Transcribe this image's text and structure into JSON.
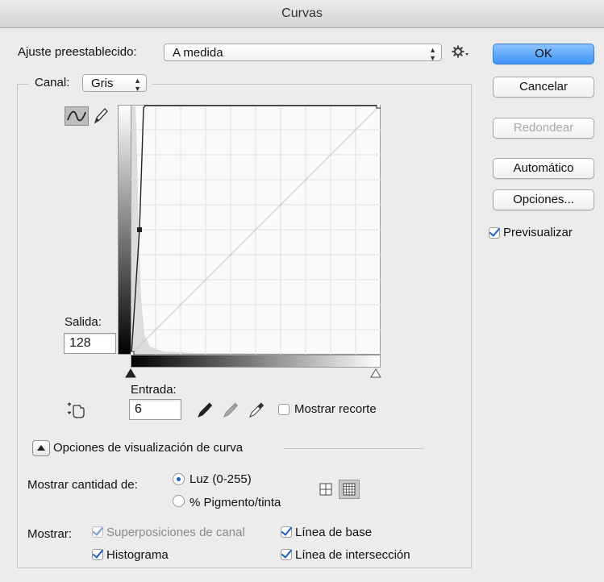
{
  "window": {
    "title": "Curvas"
  },
  "preset": {
    "label": "Ajuste preestablecido:",
    "value": "A medida",
    "settings_icon": "gear-icon"
  },
  "channel": {
    "label": "Canal:",
    "value": "Gris"
  },
  "tools": {
    "curve_icon": "curve-tool-icon",
    "pencil_icon": "pencil-icon",
    "hand_icon": "on-image-adjust-icon"
  },
  "output": {
    "label": "Salida:",
    "value": "128"
  },
  "input": {
    "label": "Entrada:",
    "value": "6"
  },
  "eyedroppers": {
    "black": "black-eyedropper-icon",
    "gray": "gray-eyedropper-icon",
    "white": "white-eyedropper-icon"
  },
  "clipping": {
    "label": "Mostrar recorte",
    "checked": false
  },
  "display_options": {
    "label": "Opciones de visualización de curva"
  },
  "show_amount": {
    "label": "Mostrar cantidad de:",
    "light": "Luz (0-255)",
    "pigment": "% Pigmento/tinta",
    "selected": "light"
  },
  "grid_icons": {
    "simple": "simple-grid-icon",
    "detailed": "detailed-grid-icon"
  },
  "show": {
    "label": "Mostrar:",
    "channel_overlays": "Superposiciones de canal",
    "histogram": "Histograma",
    "baseline": "Línea de base",
    "intersection": "Línea de intersección"
  },
  "buttons": {
    "ok": "OK",
    "cancel": "Cancelar",
    "smooth": "Redondear",
    "auto": "Automático",
    "options": "Opciones..."
  },
  "preview": {
    "label": "Previsualizar",
    "checked": true
  },
  "colors": {
    "accent": "#3d94f6",
    "check": "#1760c5"
  }
}
